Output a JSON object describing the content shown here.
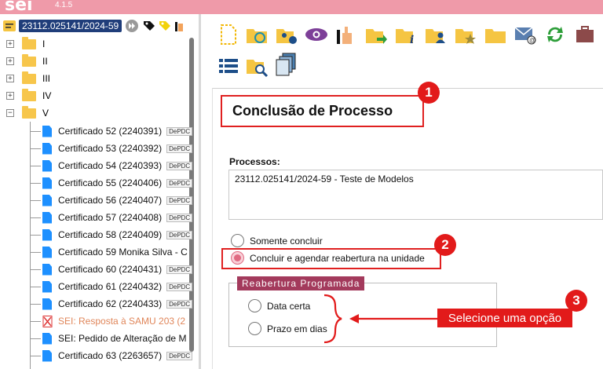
{
  "app": {
    "logo": "sei",
    "version": "4.1.5"
  },
  "tree": {
    "process_number": "23112.025141/2024-59",
    "folders": [
      {
        "label": "I"
      },
      {
        "label": "II"
      },
      {
        "label": "III"
      },
      {
        "label": "IV"
      },
      {
        "label": "V"
      }
    ],
    "documents": [
      {
        "label": "Certificado 52 (2240391)",
        "tag": "DePDC"
      },
      {
        "label": "Certificado 53 (2240392)",
        "tag": "DePDC"
      },
      {
        "label": "Certificado 54 (2240393)",
        "tag": "DePDC"
      },
      {
        "label": "Certificado 55 (2240406)",
        "tag": "DePDC"
      },
      {
        "label": "Certificado 56 (2240407)",
        "tag": "DePDC"
      },
      {
        "label": "Certificado 57 (2240408)",
        "tag": "DePDC"
      },
      {
        "label": "Certificado 58 (2240409)",
        "tag": "DePDC"
      },
      {
        "label": "Certificado 59 Monika Silva - C",
        "tag": ""
      },
      {
        "label": "Certificado 60 (2240431)",
        "tag": "DePDC"
      },
      {
        "label": "Certificado 61 (2240432)",
        "tag": "DePDC"
      },
      {
        "label": "Certificado 62 (2240433)",
        "tag": "DePDC"
      },
      {
        "label": "SEI: Resposta à SAMU 203 (2",
        "tag": ""
      },
      {
        "label": "SEI: Pedido de Alteração de M",
        "tag": ""
      },
      {
        "label": "Certificado 63 (2263657)",
        "tag": "DePDC"
      }
    ]
  },
  "form": {
    "title": "Conclusão de Processo",
    "processes_label": "Processos:",
    "processes_value": "23112.025141/2024-59 - Teste de Modelos",
    "option_only_conclude": "Somente concluir",
    "option_conclude_reopen": "Concluir e agendar reabertura na unidade",
    "reopen_legend": "Reabertura Programada",
    "option_date": "Data certa",
    "option_days": "Prazo em dias"
  },
  "annotations": {
    "badge_1": "1",
    "badge_2": "2",
    "badge_3": "3",
    "callout_text": "Selecione uma opção"
  },
  "colors": {
    "topbar": "#ef9aa9",
    "annotation_red": "#e21a1a",
    "legend_bg": "#a33a5c",
    "process_badge": "#1f3d7a"
  },
  "icons": [
    "new-document-icon",
    "process-relation-icon",
    "users-settings-icon",
    "visualize-icon",
    "sign-icon",
    "send-process-icon",
    "info-icon",
    "assign-user-icon",
    "favorite-icon",
    "folder-icon",
    "email-icon",
    "refresh-icon",
    "suitcase-icon",
    "list-icon",
    "search-folder-icon",
    "documents-icon"
  ]
}
